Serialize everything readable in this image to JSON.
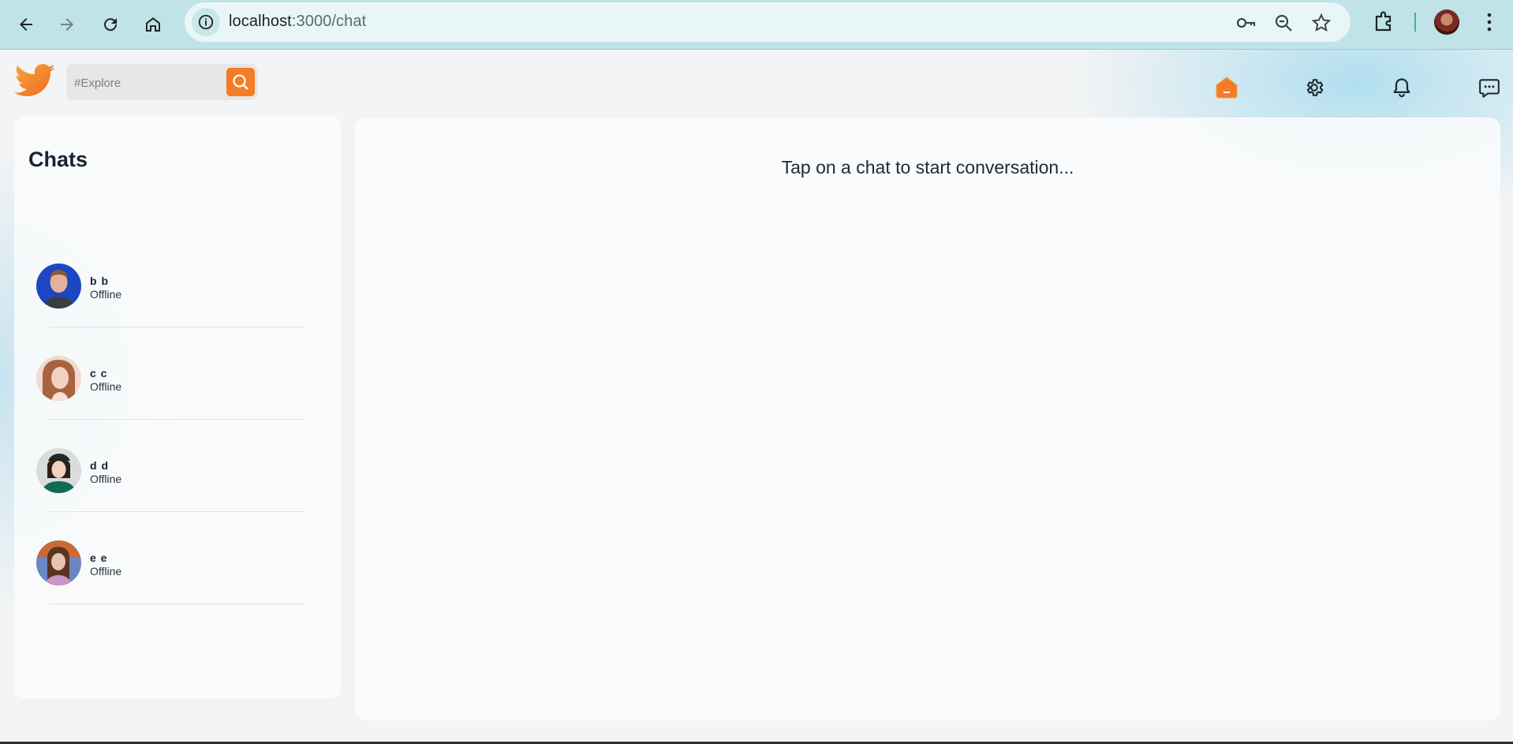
{
  "browser": {
    "url_host": "localhost",
    "url_path": ":3000/chat",
    "accent_color": "#bfe3e6",
    "icons": [
      "back-arrow-icon",
      "forward-arrow-icon",
      "reload-icon",
      "home-icon",
      "site-info-icon",
      "password-key-icon",
      "zoom-icon",
      "bookmark-star-icon",
      "extensions-icon",
      "profile-avatar",
      "more-menu-icon"
    ]
  },
  "header": {
    "logo": "twitter-bird-logo",
    "search_placeholder": "#Explore",
    "icons": [
      "home-icon",
      "settings-gear-icon",
      "notification-bell-icon",
      "messages-icon"
    ],
    "accent_color": "#f47c27"
  },
  "chats": {
    "title": "Chats",
    "items": [
      {
        "name": "b b",
        "status": "Offline"
      },
      {
        "name": "c c",
        "status": "Offline"
      },
      {
        "name": "d d",
        "status": "Offline"
      },
      {
        "name": "e e",
        "status": "Offline"
      }
    ]
  },
  "conversation": {
    "hint": "Tap on a chat to start conversation..."
  }
}
